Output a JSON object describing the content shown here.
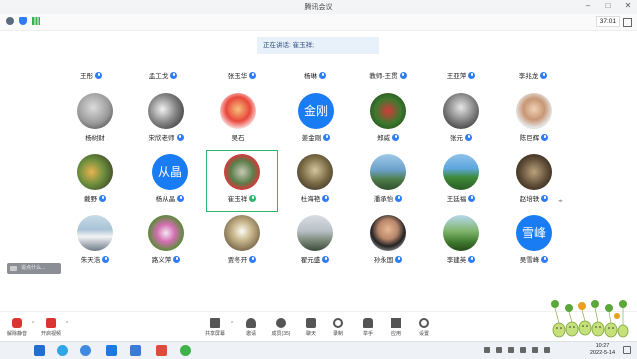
{
  "window": {
    "title": "腾讯会议"
  },
  "topbar": {
    "timer": "37:01"
  },
  "speaking": {
    "label": "正在讲话: 崔玉祥;"
  },
  "participants": [
    {
      "name": "王彤"
    },
    {
      "name": "孟工戈"
    },
    {
      "name": "张玉华"
    },
    {
      "name": "杨琳"
    },
    {
      "name": "教师-王贯"
    },
    {
      "name": "王亚萍"
    },
    {
      "name": "李兆龙"
    },
    {
      "name": "杨树财"
    },
    {
      "name": "宋欣老师"
    },
    {
      "name": "吴石"
    },
    {
      "name": "姜金刚",
      "avatar_text": "金刚"
    },
    {
      "name": "郑威"
    },
    {
      "name": "张元"
    },
    {
      "name": "陈巨辉"
    },
    {
      "name": "戴野"
    },
    {
      "name": "杨从晶",
      "avatar_text": "从晶"
    },
    {
      "name": "崔玉祥"
    },
    {
      "name": "杜海艳"
    },
    {
      "name": "潘承怡"
    },
    {
      "name": "王廷福"
    },
    {
      "name": "赵培轶"
    },
    {
      "name": "朱天浩"
    },
    {
      "name": "路义萍"
    },
    {
      "name": "贾冬开"
    },
    {
      "name": "翟元盛"
    },
    {
      "name": "孙永国"
    },
    {
      "name": "李建英"
    },
    {
      "name": "吴雪峰",
      "avatar_text": "雪峰"
    }
  ],
  "chat": {
    "placeholder": "说点什么..."
  },
  "toolbar": {
    "mic": "解除静音",
    "camera": "开启视频",
    "share": "共享屏幕",
    "invite": "邀请",
    "members": "成员(35)",
    "chat": "聊天",
    "record": "录制",
    "hand": "举手",
    "apps": "应用",
    "settings": "设置"
  },
  "taskbar": {
    "time": "10:27",
    "date": "2022-5-14"
  },
  "colors": {
    "accent": "#1a7cf2",
    "highlight": "#2cb56b",
    "mute": "#dd3333"
  }
}
